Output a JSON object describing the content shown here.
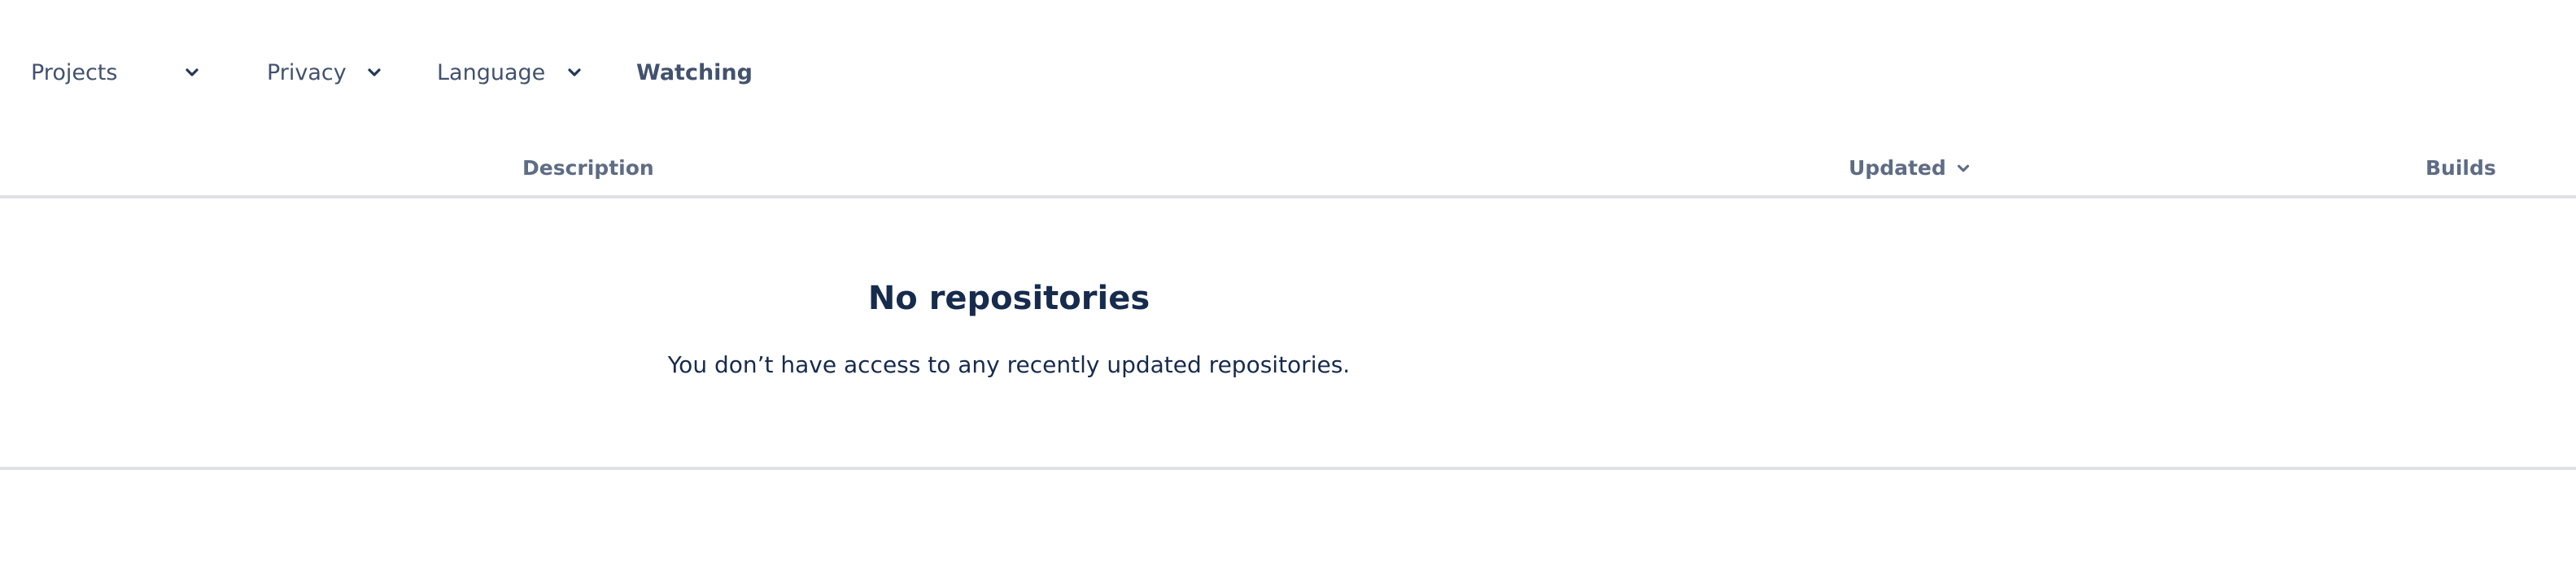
{
  "filters": {
    "projects_label": "Projects",
    "privacy_label": "Privacy",
    "language_label": "Language",
    "watching_label": "Watching"
  },
  "table": {
    "columns": {
      "description": "Description",
      "updated": "Updated",
      "builds": "Builds"
    }
  },
  "empty_state": {
    "title": "No repositories",
    "message": "You don’t have access to any recently updated repositories."
  },
  "icons": {
    "dropdown": "chevron-down-icon",
    "sort": "chevron-down-icon"
  },
  "colors": {
    "text_primary": "#172b4d",
    "text_secondary": "#42526e",
    "header_text": "#5e6c84",
    "divider": "#dfe1e6"
  }
}
